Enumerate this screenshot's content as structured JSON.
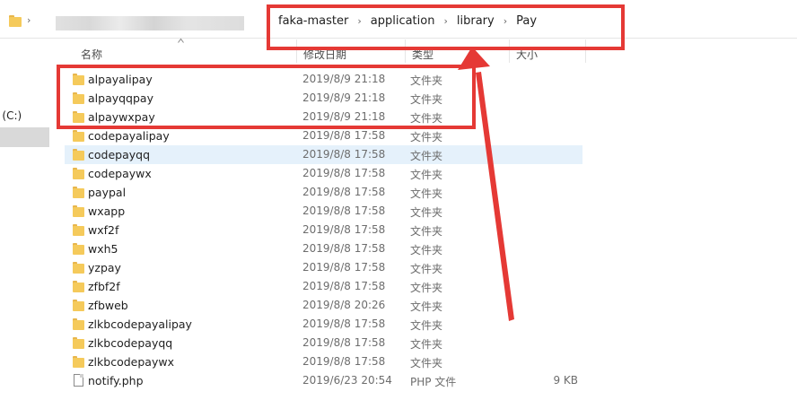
{
  "breadcrumb": {
    "separator": "›",
    "items": [
      {
        "label": "faka-master"
      },
      {
        "label": "application"
      },
      {
        "label": "library"
      },
      {
        "label": "Pay"
      }
    ]
  },
  "columns": {
    "name": "名称",
    "date": "修改日期",
    "type": "类型",
    "size": "大小"
  },
  "nav": {
    "drive_label": "c (C:)"
  },
  "files": [
    {
      "name": "alpayalipay",
      "date": "2019/8/9 21:18",
      "type": "文件夹",
      "size": "",
      "icon": "folder-icon"
    },
    {
      "name": "alpayqqpay",
      "date": "2019/8/9 21:18",
      "type": "文件夹",
      "size": "",
      "icon": "folder-icon"
    },
    {
      "name": "alpaywxpay",
      "date": "2019/8/9 21:18",
      "type": "文件夹",
      "size": "",
      "icon": "folder-icon"
    },
    {
      "name": "codepayalipay",
      "date": "2019/8/8 17:58",
      "type": "文件夹",
      "size": "",
      "icon": "folder-icon"
    },
    {
      "name": "codepayqq",
      "date": "2019/8/8 17:58",
      "type": "文件夹",
      "size": "",
      "icon": "folder-icon"
    },
    {
      "name": "codepaywx",
      "date": "2019/8/8 17:58",
      "type": "文件夹",
      "size": "",
      "icon": "folder-icon"
    },
    {
      "name": "paypal",
      "date": "2019/8/8 17:58",
      "type": "文件夹",
      "size": "",
      "icon": "folder-icon"
    },
    {
      "name": "wxapp",
      "date": "2019/8/8 17:58",
      "type": "文件夹",
      "size": "",
      "icon": "folder-icon"
    },
    {
      "name": "wxf2f",
      "date": "2019/8/8 17:58",
      "type": "文件夹",
      "size": "",
      "icon": "folder-icon"
    },
    {
      "name": "wxh5",
      "date": "2019/8/8 17:58",
      "type": "文件夹",
      "size": "",
      "icon": "folder-icon"
    },
    {
      "name": "yzpay",
      "date": "2019/8/8 17:58",
      "type": "文件夹",
      "size": "",
      "icon": "folder-icon"
    },
    {
      "name": "zfbf2f",
      "date": "2019/8/8 17:58",
      "type": "文件夹",
      "size": "",
      "icon": "folder-icon"
    },
    {
      "name": "zfbweb",
      "date": "2019/8/8 20:26",
      "type": "文件夹",
      "size": "",
      "icon": "folder-icon"
    },
    {
      "name": "zlkbcodepayalipay",
      "date": "2019/8/8 17:58",
      "type": "文件夹",
      "size": "",
      "icon": "folder-icon"
    },
    {
      "name": "zlkbcodepayqq",
      "date": "2019/8/8 17:58",
      "type": "文件夹",
      "size": "",
      "icon": "folder-icon"
    },
    {
      "name": "zlkbcodepaywx",
      "date": "2019/8/8 17:58",
      "type": "文件夹",
      "size": "",
      "icon": "folder-icon"
    },
    {
      "name": "notify.php",
      "date": "2019/6/23 20:54",
      "type": "PHP 文件",
      "size": "9 KB",
      "icon": "php-file-icon"
    }
  ],
  "colors": {
    "annotation_red": "#e53935",
    "folder_yellow": "#f5ca5b",
    "hover_row": "#e5f1fb"
  }
}
